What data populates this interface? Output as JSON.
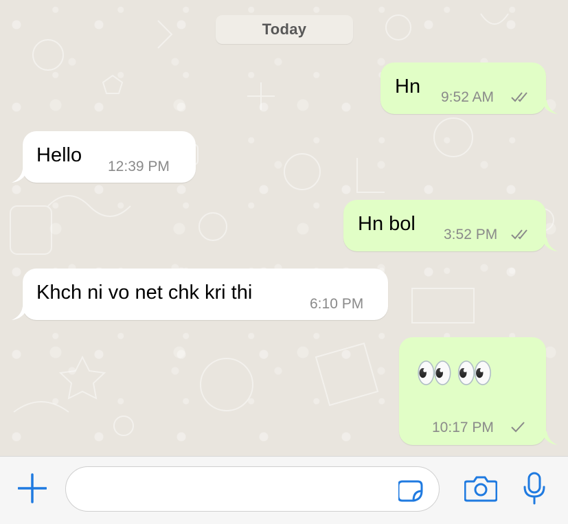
{
  "chat": {
    "date_label": "Today",
    "messages": [
      {
        "direction": "out",
        "text": "Hn",
        "time": "9:52 AM",
        "status": "read"
      },
      {
        "direction": "in",
        "text": "Hello",
        "time": "12:39 PM"
      },
      {
        "direction": "out",
        "text": "Hn bol",
        "time": "3:52 PM",
        "status": "read"
      },
      {
        "direction": "in",
        "text": "Khch ni vo net chk kri thi",
        "time": "6:10 PM"
      },
      {
        "direction": "out",
        "text": "👀👀",
        "time": "10:17 PM",
        "status": "sent"
      }
    ]
  },
  "composer": {
    "input_value": "",
    "icons": [
      "plus-icon",
      "sticker-icon",
      "camera-icon",
      "microphone-icon"
    ],
    "accent_color": "#1f7ae0"
  },
  "colors": {
    "incoming_bubble": "#ffffff",
    "outgoing_bubble": "#e1fec6",
    "chat_background": "#e9e5de",
    "tick_color": "#8a8a8a"
  }
}
